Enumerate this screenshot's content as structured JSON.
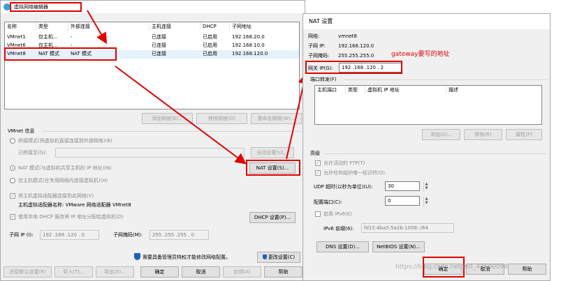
{
  "left_window": {
    "title": "虚拟网络编辑器",
    "columns": [
      "名称",
      "类型",
      "外部连接",
      "主机连接",
      "DHCP",
      "子网地址"
    ],
    "rows": [
      [
        "VMnet1",
        "仅主机...",
        "-",
        "已连接",
        "已启用",
        "192.168.20.0"
      ],
      [
        "VMnet6",
        "仅主机...",
        "-",
        "已连接",
        "已启用",
        "192.168.10.0"
      ],
      [
        "VMnet8",
        "NAT 模式",
        "NAT 模式",
        "已连接",
        "已启用",
        "192.168.120.0"
      ]
    ],
    "list_buttons": [
      "添加网络(E)...",
      "移除网络(O)",
      "重命名网络(W)..."
    ],
    "vmnet_info_label": "VMnet 信息",
    "bridge_radio": "桥接模式(将虚拟机直接连接到外部网络)(B)",
    "bridge_to_label": "已桥接至(G):",
    "auto_settings_button": "自动设置(U)...",
    "nat_radio": "NAT 模式(与虚拟机共享主机的 IP 地址)(N)",
    "nat_settings_button": "NAT 设置(S)...",
    "hostonly_radio": "仅主机模式(在专用网络内连接虚拟机)(H)",
    "connect_adapter_check": "将主机虚拟适配器连接到此网络(V)",
    "adapter_name_text": "主机虚拟适配器名称: VMware 网络适配器 VMnet8",
    "dhcp_check": "使用本地 DHCP 服务将 IP 地址分配给虚拟机(D)",
    "dhcp_settings_button": "DHCP 设置(P)...",
    "subnet_ip_label": "子网 IP (I):",
    "subnet_ip_value": "192 .168 .120 . 0",
    "subnet_mask_label": "子网掩码(M):",
    "subnet_mask_value": "255 .255 .255 . 0",
    "admin_notice": "需要具备管理员特权才能修改网络配置。",
    "change_settings_button": "更改设置(C)",
    "footer_buttons": [
      "还原默认设置(R)",
      "导入(T)...",
      "导出(X)...",
      "确定",
      "取消",
      "应用(A)",
      "帮助"
    ]
  },
  "nat_window": {
    "title": "NAT 设置",
    "network_label": "网络:",
    "network_value": "vmnet8",
    "subnet_ip_label": "子网 IP:",
    "subnet_ip_value": "192.168.120.0",
    "subnet_mask_label": "子网掩码:",
    "subnet_mask_value": "255.255.255.0",
    "gateway_label": "网关 IP(G):",
    "gateway_value": "192 .168 .120 . 2",
    "annotation": "gateway要写的地址",
    "port_forward_label": "端口转发(F)",
    "port_columns": [
      "主机端口",
      "类型",
      "虚拟机 IP 地址",
      "描述"
    ],
    "port_buttons": [
      "添加(A)...",
      "移除(R)",
      "属性(P)"
    ],
    "advanced_label": "高级",
    "allow_ftp": "允许活动的 FTP(T)",
    "allow_any_oui": "允许任何组织唯一标识符(O)",
    "udp_timeout_label": "UDP 超时(以秒为单位)(U):",
    "udp_timeout_value": "30",
    "config_port_label": "配置端口(C):",
    "config_port_value": "0",
    "enable_ipv6": "启用 IPv6(E)",
    "ipv6_prefix_label": "IPv6 前缀(6):",
    "ipv6_prefix_value": "fd15:4ba5:5a2b:1008::/64",
    "dns_button": "DNS 设置(D)...",
    "netbios_button": "NetBIOS 设置(N)...",
    "ok_button": "确定",
    "cancel_button": "取消",
    "help_button": "帮助"
  },
  "watermark": "https://blog.csdn.net/m0_43600098",
  "colors": {
    "annotation_red": "#e00000",
    "selected_row": "#e5f1fb",
    "shield_blue": "#1f5fbf"
  }
}
